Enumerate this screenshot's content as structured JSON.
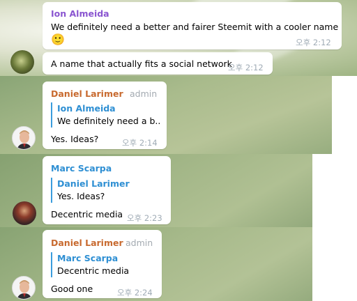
{
  "messages": [
    {
      "sender": "Ion Almeida",
      "text": "We definitely need a better and fairer Steemit with a cooler name",
      "emoji": "🙂",
      "time": "오후 2:12"
    },
    {
      "text": "A name that actually fits a social network",
      "time": "오후 2:12"
    },
    {
      "sender": "Daniel Larimer",
      "role": "admin",
      "reply": {
        "name": "Ion Almeida",
        "text": "We definitely need a b..."
      },
      "text": "Yes.  Ideas?",
      "time": "오후 2:14"
    },
    {
      "sender": "Marc Scarpa",
      "reply": {
        "name": "Daniel Larimer",
        "text": "Yes.  Ideas?"
      },
      "text": "Decentric media",
      "time": "오후 2:23"
    },
    {
      "sender": "Daniel Larimer",
      "role": "admin",
      "reply": {
        "name": "Marc Scarpa",
        "text": "Decentric media"
      },
      "text": "Good one",
      "time": "오후 2:24"
    }
  ],
  "colors": {
    "ion_almeida": "#8a55d0",
    "daniel_larimer": "#c86a2f",
    "marc_scarpa": "#2e8fd3",
    "reply_bar": "#3b9ddd",
    "time": "#a0acb6"
  }
}
